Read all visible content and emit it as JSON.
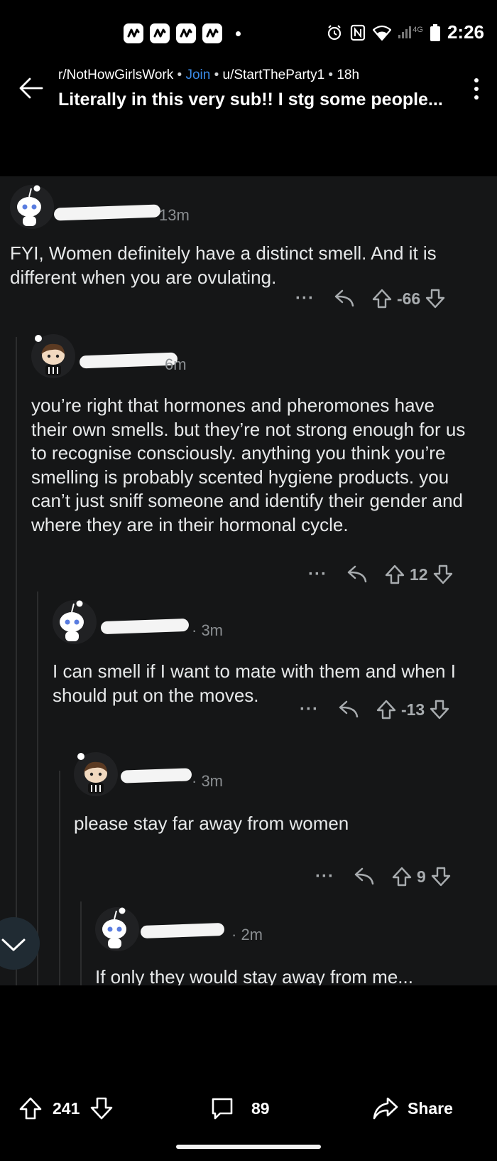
{
  "status_bar": {
    "time": "2:26",
    "network": "4G",
    "notification_icons": [
      "app-notification-icon",
      "app-notification-icon",
      "app-notification-icon",
      "app-notification-icon"
    ]
  },
  "header": {
    "subreddit": "r/NotHowGirlsWork",
    "join_label": "Join",
    "author": "u/StartTheParty1",
    "age": "18h",
    "bullet": "•",
    "title": "Literally in this very sub!! I stg some people..."
  },
  "comments": [
    {
      "time": "13m",
      "body": "FYI, Women definitely have a distinct smell. And it is different when you are ovulating.",
      "score": "-66",
      "more": "···"
    },
    {
      "time": "6m",
      "body": "you’re right that hormones and pheromones have their own smells. but they’re not strong enough for us to recognise consciously. anything you think you’re smelling is probably scented hygiene products. you can’t just sniff someone and identify their gender and where they are in their hormonal cycle.",
      "score": "12",
      "more": "···"
    },
    {
      "time": "· 3m",
      "body": "I can smell if I want to mate with them and when I should put on the moves.",
      "score": "-13",
      "more": "···"
    },
    {
      "time": "· 3m",
      "body": "please stay far away from women",
      "score": "9",
      "more": "···"
    },
    {
      "time": "· 2m",
      "body": "If only they would stay away from me..."
    }
  ],
  "bottom_bar": {
    "upvotes": "241",
    "comments": "89",
    "share_label": "Share"
  },
  "colors": {
    "background": "#000000",
    "comment_background": "#151617",
    "join_link": "#3b8be8",
    "muted_text": "#8b8f92"
  }
}
